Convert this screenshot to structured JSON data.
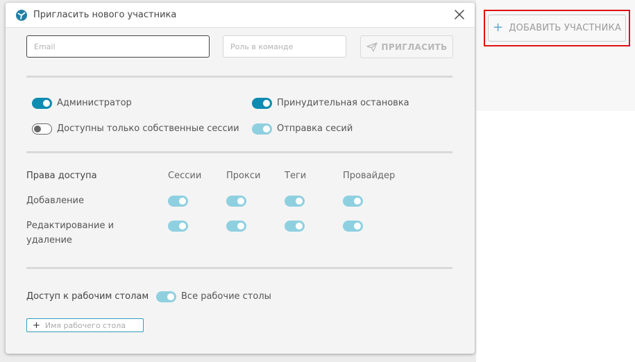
{
  "background": {
    "add_member_button": "ДОБАВИТЬ УЧАСТНИКА"
  },
  "modal": {
    "title": "Пригласить нового участника",
    "email_placeholder": "Email",
    "role_placeholder": "Роль в команде",
    "invite_button": "ПРИГЛАСИТЬ",
    "roles": [
      {
        "label": "Администратор",
        "state": "on"
      },
      {
        "label": "Принудительная остановка",
        "state": "on"
      },
      {
        "label": "Доступны только собственные сессии",
        "state": "off"
      },
      {
        "label": "Отправка сесий",
        "state": "on-disabled"
      }
    ],
    "permissions": {
      "header": "Права доступа",
      "columns": [
        "Сессии",
        "Прокси",
        "Теги",
        "Провайдер"
      ],
      "rows": [
        {
          "label": "Добавление",
          "values": [
            "on-disabled",
            "on-disabled",
            "on-disabled",
            "on-disabled"
          ]
        },
        {
          "label_line1": "Редактирование и",
          "label_line2": "удаление",
          "values": [
            "on-disabled",
            "on-disabled",
            "on-disabled",
            "on-disabled"
          ]
        }
      ]
    },
    "desktops": {
      "label": "Доступ к рабочим столам",
      "all_desktops_label": "Все рабочие столы",
      "all_desktops_state": "on-disabled",
      "add_desktop_placeholder": "Имя рабочего стола"
    }
  },
  "colors": {
    "accent": "#0d8bb0",
    "accent_light": "#8fd0e0",
    "highlight_border": "#e01010"
  },
  "icons": [
    "app-logo-icon",
    "close-icon",
    "send-icon",
    "plus-icon"
  ]
}
